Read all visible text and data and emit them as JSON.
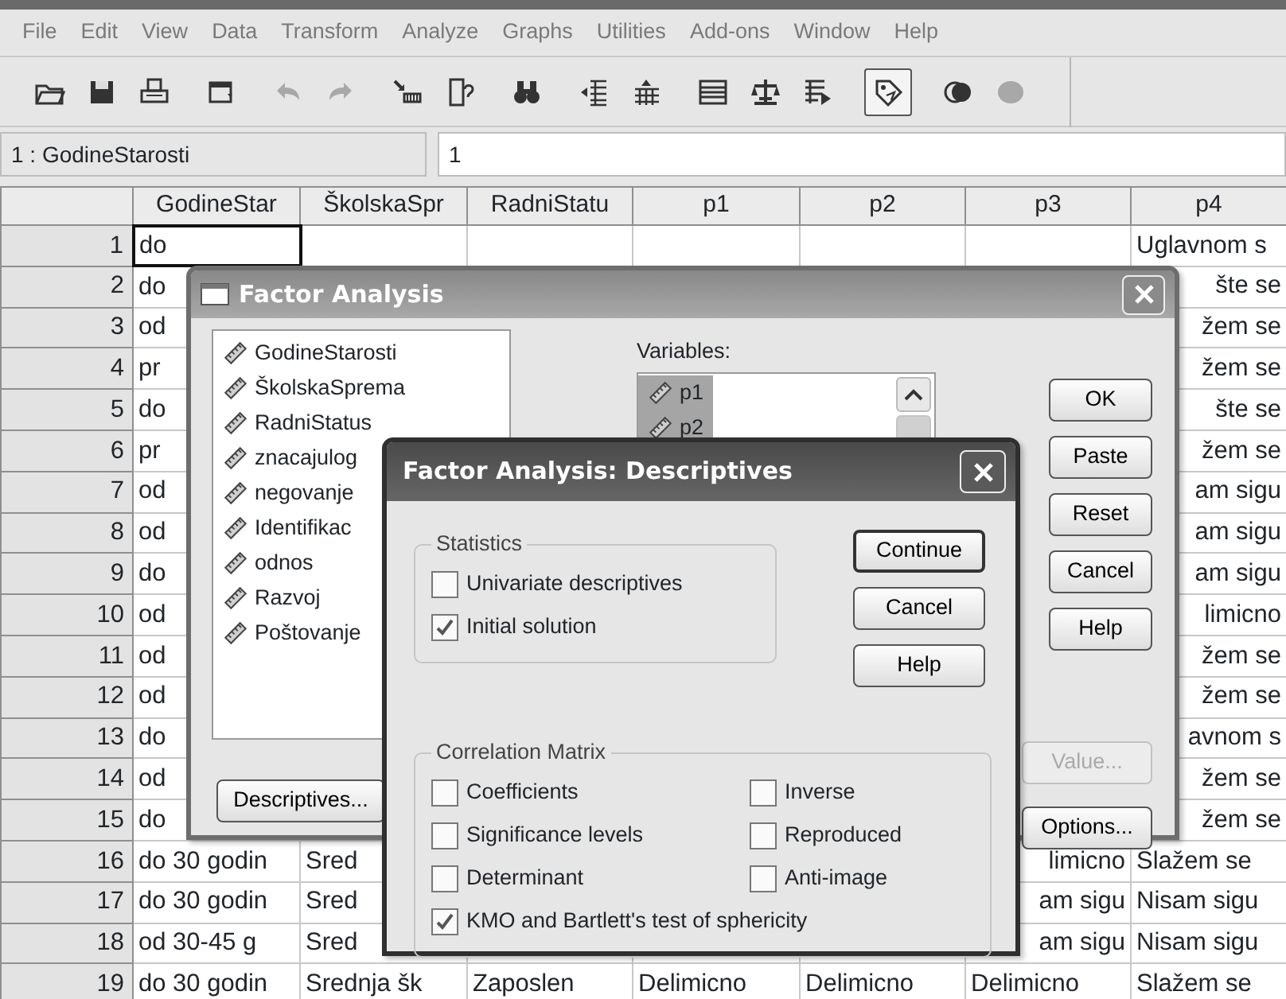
{
  "menu": [
    "File",
    "Edit",
    "View",
    "Data",
    "Transform",
    "Analyze",
    "Graphs",
    "Utilities",
    "Add-ons",
    "Window",
    "Help"
  ],
  "toolbar": [
    {
      "pressed": false,
      "disabled": false
    },
    {
      "pressed": false,
      "disabled": false
    },
    {
      "pressed": false,
      "disabled": false
    },
    {
      "pressed": false,
      "disabled": false
    },
    {
      "pressed": false,
      "disabled": true
    },
    {
      "pressed": false,
      "disabled": true
    },
    {
      "pressed": false,
      "disabled": false
    },
    {
      "pressed": false,
      "disabled": false
    },
    {
      "pressed": false,
      "disabled": false
    },
    {
      "pressed": false,
      "disabled": false
    },
    {
      "pressed": false,
      "disabled": false
    },
    {
      "pressed": false,
      "disabled": false
    },
    {
      "pressed": false,
      "disabled": false
    },
    {
      "pressed": false,
      "disabled": false
    },
    {
      "pressed": true,
      "disabled": false
    },
    {
      "pressed": false,
      "disabled": false
    },
    {
      "pressed": false,
      "disabled": true
    }
  ],
  "cell_reference": "1 : GodineStarosti",
  "cell_value": "1",
  "grid": {
    "columns": [
      "GodineStar",
      "ŠkolskaSpr",
      "RadniStatu",
      "p1",
      "p2",
      "p3",
      "p4"
    ],
    "rows": [
      {
        "number": "1",
        "cells": [
          {
            "text": "do",
            "active": true,
            "clipped_left": false
          },
          null,
          null,
          null,
          null,
          null,
          {
            "text": "Uglavnom s",
            "active": false,
            "clipped_left": false
          }
        ]
      },
      {
        "number": "2",
        "cells": [
          {
            "text": "do",
            "active": false,
            "clipped_left": false
          },
          null,
          null,
          null,
          null,
          null,
          {
            "text": "šte se",
            "active": false,
            "clipped_left": true
          }
        ]
      },
      {
        "number": "3",
        "cells": [
          {
            "text": "od",
            "active": false,
            "clipped_left": false
          },
          null,
          null,
          null,
          null,
          null,
          {
            "text": "žem se",
            "active": false,
            "clipped_left": true
          }
        ]
      },
      {
        "number": "4",
        "cells": [
          {
            "text": "pr",
            "active": false,
            "clipped_left": false
          },
          null,
          null,
          null,
          null,
          null,
          {
            "text": "žem se",
            "active": false,
            "clipped_left": true
          }
        ]
      },
      {
        "number": "5",
        "cells": [
          {
            "text": "do",
            "active": false,
            "clipped_left": false
          },
          null,
          null,
          null,
          null,
          null,
          {
            "text": "šte se",
            "active": false,
            "clipped_left": true
          }
        ]
      },
      {
        "number": "6",
        "cells": [
          {
            "text": "pr",
            "active": false,
            "clipped_left": false
          },
          null,
          null,
          null,
          null,
          null,
          {
            "text": "žem se",
            "active": false,
            "clipped_left": true
          }
        ]
      },
      {
        "number": "7",
        "cells": [
          {
            "text": "od",
            "active": false,
            "clipped_left": false
          },
          null,
          null,
          null,
          null,
          null,
          {
            "text": "am sigu",
            "active": false,
            "clipped_left": true
          }
        ]
      },
      {
        "number": "8",
        "cells": [
          {
            "text": "od",
            "active": false,
            "clipped_left": false
          },
          null,
          null,
          null,
          null,
          null,
          {
            "text": "am sigu",
            "active": false,
            "clipped_left": true
          }
        ]
      },
      {
        "number": "9",
        "cells": [
          {
            "text": "do",
            "active": false,
            "clipped_left": false
          },
          null,
          null,
          null,
          null,
          null,
          {
            "text": "am sigu",
            "active": false,
            "clipped_left": true
          }
        ]
      },
      {
        "number": "10",
        "cells": [
          {
            "text": "od",
            "active": false,
            "clipped_left": false
          },
          null,
          null,
          null,
          null,
          null,
          {
            "text": "limicno",
            "active": false,
            "clipped_left": true
          }
        ]
      },
      {
        "number": "11",
        "cells": [
          {
            "text": "od",
            "active": false,
            "clipped_left": false
          },
          null,
          null,
          null,
          null,
          null,
          {
            "text": "žem se",
            "active": false,
            "clipped_left": true
          }
        ]
      },
      {
        "number": "12",
        "cells": [
          {
            "text": "od",
            "active": false,
            "clipped_left": false
          },
          null,
          null,
          null,
          null,
          null,
          {
            "text": "žem se",
            "active": false,
            "clipped_left": true
          }
        ]
      },
      {
        "number": "13",
        "cells": [
          {
            "text": "do",
            "active": false,
            "clipped_left": false
          },
          null,
          null,
          null,
          null,
          null,
          {
            "text": "avnom s",
            "active": false,
            "clipped_left": true
          }
        ]
      },
      {
        "number": "14",
        "cells": [
          {
            "text": "od",
            "active": false,
            "clipped_left": false
          },
          null,
          null,
          null,
          null,
          null,
          {
            "text": "žem se",
            "active": false,
            "clipped_left": true
          }
        ]
      },
      {
        "number": "15",
        "cells": [
          {
            "text": "do",
            "active": false,
            "clipped_left": false
          },
          null,
          null,
          null,
          null,
          null,
          {
            "text": "žem se",
            "active": false,
            "clipped_left": true
          }
        ]
      },
      {
        "number": "16",
        "cells": [
          {
            "text": "do 30 godin",
            "active": false,
            "clipped_left": false
          },
          {
            "text": "Sred",
            "active": false,
            "clipped_left": false
          },
          null,
          null,
          null,
          {
            "text": "limicno",
            "active": false,
            "clipped_left": true
          },
          {
            "text": "Slažem se",
            "active": false,
            "clipped_left": false
          }
        ]
      },
      {
        "number": "17",
        "cells": [
          {
            "text": "do 30 godin",
            "active": false,
            "clipped_left": false
          },
          {
            "text": "Sred",
            "active": false,
            "clipped_left": false
          },
          null,
          null,
          null,
          {
            "text": "am sigu",
            "active": false,
            "clipped_left": true
          },
          {
            "text": "Nisam sigu",
            "active": false,
            "clipped_left": false
          }
        ]
      },
      {
        "number": "18",
        "cells": [
          {
            "text": "od 30-45 g",
            "active": false,
            "clipped_left": false
          },
          {
            "text": "Sred",
            "active": false,
            "clipped_left": false
          },
          null,
          null,
          null,
          {
            "text": "am sigu",
            "active": false,
            "clipped_left": true
          },
          {
            "text": "Nisam sigu",
            "active": false,
            "clipped_left": false
          }
        ]
      },
      {
        "number": "19",
        "cells": [
          {
            "text": "do 30 godin",
            "active": false,
            "clipped_left": false
          },
          {
            "text": "Srednja šk",
            "active": false,
            "clipped_left": false
          },
          {
            "text": "Zaposlen",
            "active": false,
            "clipped_left": false
          },
          {
            "text": "Delimicno",
            "active": false,
            "clipped_left": false
          },
          {
            "text": "Delimicno",
            "active": false,
            "clipped_left": false
          },
          {
            "text": "Delimicno",
            "active": false,
            "clipped_left": false
          },
          {
            "text": "Slažem se",
            "active": false,
            "clipped_left": false
          }
        ]
      }
    ]
  },
  "factor_analysis": {
    "title": "Factor Analysis",
    "source_items": [
      {
        "label": "GodineStarosti",
        "selected": false
      },
      {
        "label": "ŠkolskaSprema",
        "selected": false
      },
      {
        "label": "RadniStatus",
        "selected": false
      },
      {
        "label": "znacajulog",
        "selected": false
      },
      {
        "label": "negovanje",
        "selected": false
      },
      {
        "label": "Identifikac",
        "selected": false
      },
      {
        "label": "odnos",
        "selected": false
      },
      {
        "label": "Razvoj",
        "selected": false
      },
      {
        "label": "Poštovanje",
        "selected": false
      }
    ],
    "variables_label": "Variables:",
    "variables": [
      {
        "label": "p1",
        "selected": true
      },
      {
        "label": "p2",
        "selected": true
      }
    ],
    "buttons": [
      "OK",
      "Paste",
      "Reset",
      "Cancel",
      "Help"
    ],
    "value_button": {
      "label": "Value...",
      "disabled": true
    },
    "descriptives_button": "Descriptives...",
    "options_button": "Options..."
  },
  "descriptives": {
    "title": "Factor Analysis: Descriptives",
    "statistics": {
      "legend": "Statistics",
      "options": [
        {
          "label": "Univariate descriptives",
          "checked": false
        },
        {
          "label": "Initial solution",
          "checked": true
        }
      ]
    },
    "buttons": [
      {
        "label": "Continue",
        "default": true
      },
      {
        "label": "Cancel",
        "default": false
      },
      {
        "label": "Help",
        "default": false
      }
    ],
    "correlation": {
      "legend": "Correlation Matrix",
      "options": [
        {
          "label": "Coefficients",
          "checked": false
        },
        {
          "label": "Inverse",
          "checked": false
        },
        {
          "label": "Significance levels",
          "checked": false
        },
        {
          "label": "Reproduced",
          "checked": false
        },
        {
          "label": "Determinant",
          "checked": false
        },
        {
          "label": "Anti-image",
          "checked": false
        },
        {
          "label": "KMO and Bartlett's test of sphericity",
          "checked": true
        }
      ]
    }
  }
}
